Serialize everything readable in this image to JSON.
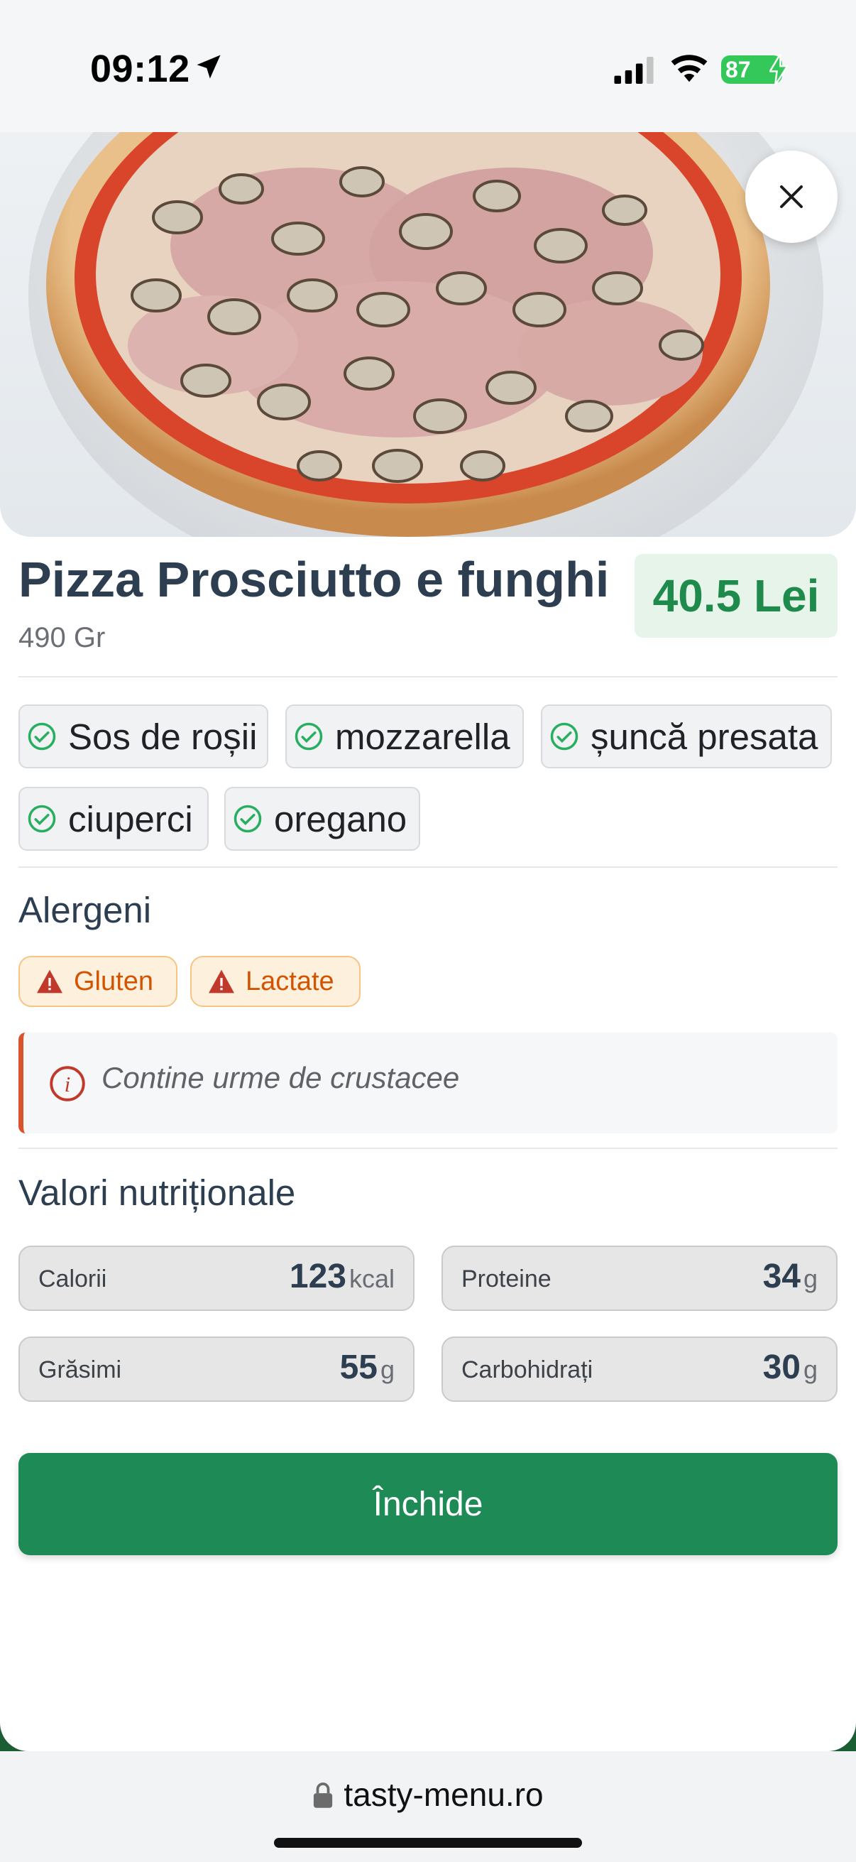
{
  "status_bar": {
    "time": "09:12",
    "battery": "87"
  },
  "dish": {
    "name": "Pizza Prosciutto e funghi",
    "weight": "490 Gr",
    "price": "40.5 Lei"
  },
  "ingredients": [
    "Sos de roșii",
    "mozzarella",
    "șuncă presata",
    "ciuperci",
    "oregano"
  ],
  "allergens": {
    "title": "Alergeni",
    "items": [
      "Gluten",
      "Lactate"
    ],
    "note": "Contine urme de crustacee"
  },
  "nutrition": {
    "title": "Valori nutriționale",
    "items": [
      {
        "label": "Calorii",
        "value": "123",
        "unit": "kcal"
      },
      {
        "label": "Proteine",
        "value": "34",
        "unit": "g"
      },
      {
        "label": "Grăsimi",
        "value": "55",
        "unit": "g"
      },
      {
        "label": "Carbohidrați",
        "value": "30",
        "unit": "g"
      }
    ]
  },
  "actions": {
    "close_label": "Închide"
  },
  "browser": {
    "url": "tasty-menu.ro"
  },
  "colors": {
    "accent": "#1e8a55",
    "price_bg": "#e6f4ea",
    "allergen": "#d35400",
    "title": "#2c3e50"
  }
}
